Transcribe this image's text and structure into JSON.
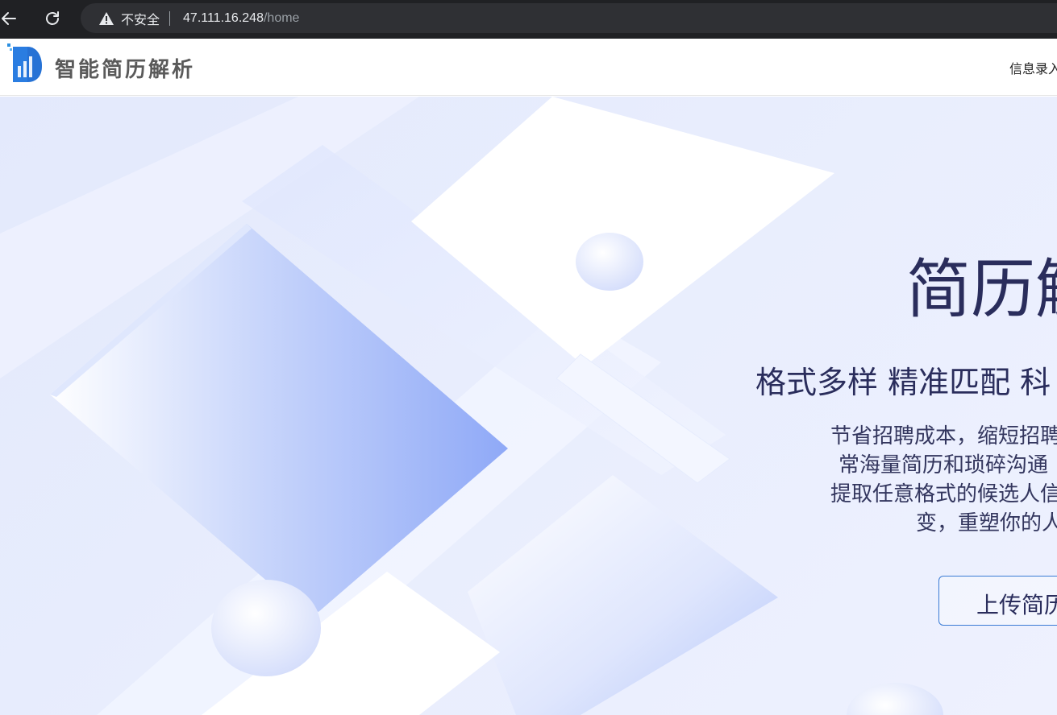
{
  "browser": {
    "security_label": "不安全",
    "url_host": "47.111.16.248",
    "url_path": "/home"
  },
  "header": {
    "brand": "智能简历解析",
    "nav_link": "信息录入"
  },
  "hero": {
    "title": "简历解",
    "subtitle": "格式多样 精准匹配 科",
    "desc_lines": [
      "节省招聘成本，缩短招聘",
      "常海量简历和琐碎沟通",
      "提取任意格式的候选人信",
      "变，重塑你的人"
    ],
    "upload_label": "上传简历"
  },
  "colors": {
    "title_text": "#2a2d5c",
    "upload_border": "#3a7bd5",
    "hero_bg": "#e8edfd",
    "browser_bar": "#202124"
  }
}
